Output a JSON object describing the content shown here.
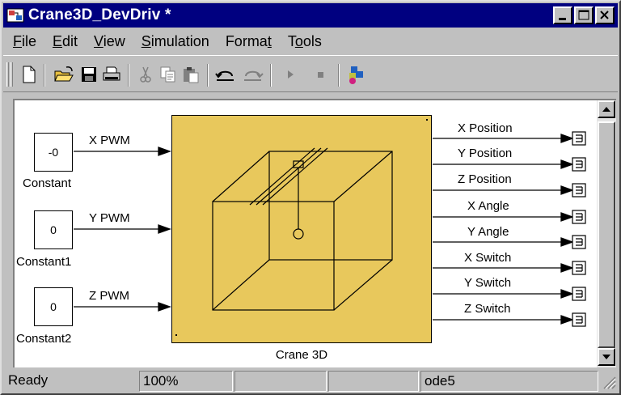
{
  "window": {
    "title": "Crane3D_DevDriv *"
  },
  "menu": {
    "items": [
      {
        "label": "File",
        "underline": "F",
        "rest": "ile"
      },
      {
        "label": "Edit",
        "underline": "E",
        "rest": "dit"
      },
      {
        "label": "View",
        "underline": "V",
        "rest": "iew"
      },
      {
        "label": "Simulation",
        "underline": "S",
        "rest": "imulation"
      },
      {
        "label": "Format",
        "pre": "Forma",
        "underline": "t",
        "rest": ""
      },
      {
        "label": "Tools",
        "pre": "T",
        "underline": "o",
        "rest": "ols"
      }
    ]
  },
  "diagram": {
    "constants": [
      {
        "value": "-0",
        "label": "Constant",
        "signal": "X PWM"
      },
      {
        "value": "0",
        "label": "Constant1",
        "signal": "Y PWM"
      },
      {
        "value": "0",
        "label": "Constant2",
        "signal": "Z PWM"
      }
    ],
    "subsystem_label": "Crane 3D",
    "outputs": [
      "X Position",
      "Y Position",
      "Z Position",
      "X Angle",
      "Y Angle",
      "X Switch",
      "Y Switch",
      "Z Switch"
    ]
  },
  "status": {
    "state": "Ready",
    "zoom": "100%",
    "solver": "ode5"
  }
}
